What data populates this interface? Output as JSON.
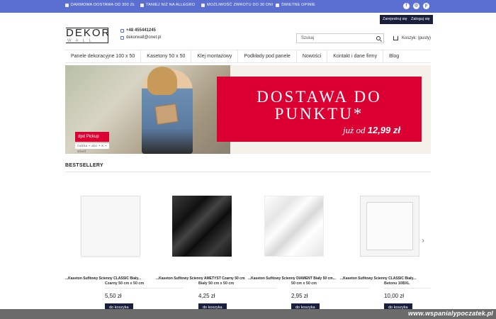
{
  "topbar": {
    "items": [
      "DARMOWA DOSTAWA OD 300 ZŁ",
      "TANIEJ NIŻ NA ALLEGRO",
      "MOŻLIWOŚĆ ZWROTU DO 30 DNI",
      "ŚWIETNE OPINIE"
    ],
    "social": [
      "facebook-icon",
      "instagram-icon",
      "pinterest-icon"
    ]
  },
  "account": {
    "register": "Zarejestruj się",
    "login": "Zaloguj się"
  },
  "header": {
    "logo_main": "DEKOR",
    "logo_sub": "WALL",
    "phone": "+48 455441245",
    "email": "dekorwall@onet.pl",
    "search_placeholder": "Szukaj",
    "cart": "Koszyk: (pusty)"
  },
  "nav": [
    "Panele dekoracyjne 100 x 50",
    "Kasetony 50 x 50",
    "Klej montażowy",
    "Podkłady pod panele",
    "Nowości",
    "Kontakt i dane firmy",
    "Blog"
  ],
  "banner": {
    "line1": "DOSTAWA DO",
    "line2": "PUNKTU*",
    "line3_prefix": "już od",
    "line3_price": "12,99 zł",
    "badge": "dpd  Pickup",
    "logos": "żabka  •  abc  •  K  •  Shell"
  },
  "bestsellers": {
    "title": "BESTSELLERY",
    "products": [
      {
        "title_overlap": "...Kaseton Sufitowy Ścienny CLASSIC Biały...",
        "subtitle": "Czarny 50 cm x 50 cm",
        "price": "5,50 zł",
        "button": "do koszyka"
      },
      {
        "title_overlap": "...Kaseton Sufitowy Ścienny AMETYST Czarny 50 cm...",
        "subtitle": "Biały 50 cm x 50 cm",
        "price": "4,25 zł",
        "button": "do koszyka"
      },
      {
        "title_overlap": "...Kaseton Sufitowy Ścienny DIAMENT Biały 50 cm...",
        "subtitle": "50 cm x 50 cm",
        "price": "2,95 zł",
        "button": "do koszyka"
      },
      {
        "title_overlap": "...Kaseton Sufitowy Ścienny CLASSIC Biały...",
        "subtitle": "Betonu 10BXL",
        "price": "10,00 zł",
        "button": "do koszyka"
      }
    ]
  },
  "watermark": "www.wspanialypoczatek.pl"
}
